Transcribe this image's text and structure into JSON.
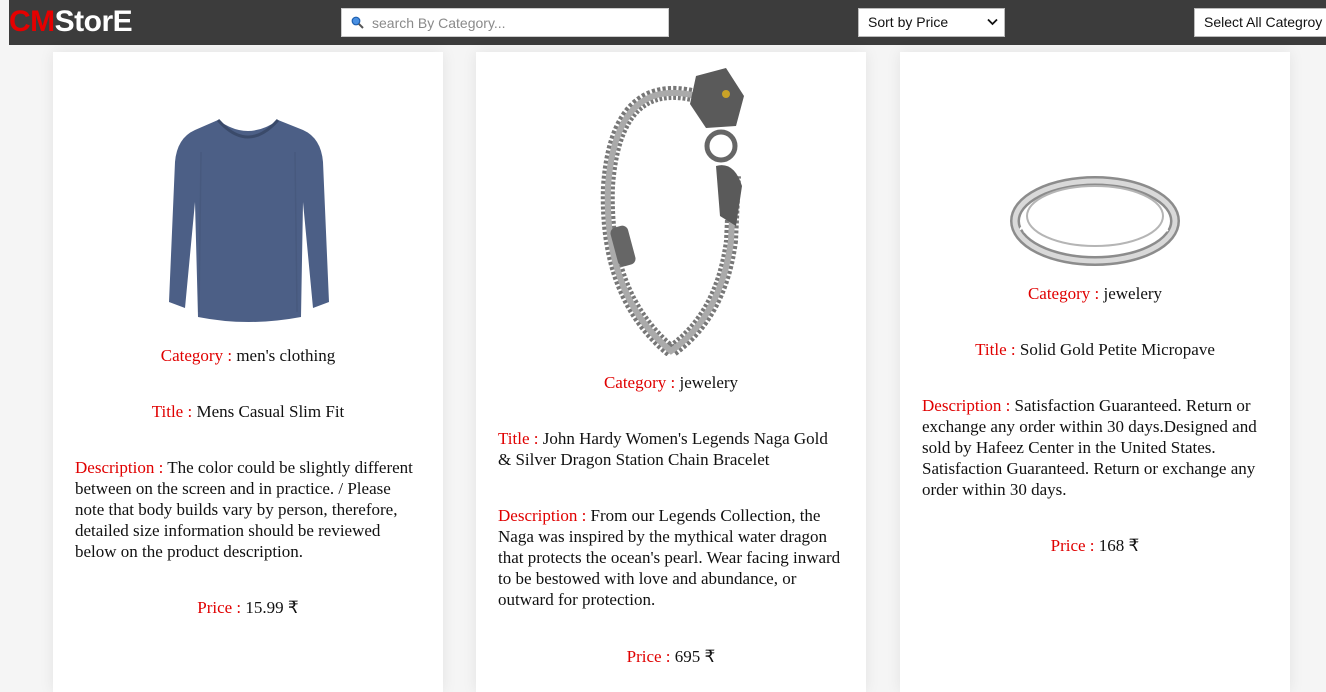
{
  "brand": {
    "prefix": "CM",
    "suffix": "StorE"
  },
  "search": {
    "placeholder": "search By Category..."
  },
  "sort": {
    "selected": "Sort by Price"
  },
  "category_select": {
    "selected": "Select All Categroy"
  },
  "labels": {
    "category": "Category : ",
    "title": "Title : ",
    "description": "Description : ",
    "price": "Price : "
  },
  "products": [
    {
      "image": "long-sleeve-shirt-image",
      "category": "men's clothing",
      "title": "Mens Casual Slim Fit",
      "description": "The color could be slightly different between on the screen and in practice. / Please note that body builds vary by person, therefore, detailed size information should be reviewed below on the product description.",
      "price": "15.99 ₹"
    },
    {
      "image": "dragon-bracelet-image",
      "category": "jewelery",
      "title": "John Hardy Women's Legends Naga Gold & Silver Dragon Station Chain Bracelet",
      "description": "From our Legends Collection, the Naga was inspired by the mythical water dragon that protects the ocean's pearl. Wear facing inward to be bestowed with love and abundance, or outward for protection.",
      "price": "695 ₹"
    },
    {
      "image": "ring-image",
      "category": "jewelery",
      "title": "Solid Gold Petite Micropave",
      "description": "Satisfaction Guaranteed. Return or exchange any order within 30 days.Designed and sold by Hafeez Center in the United States. Satisfaction Guaranteed. Return or exchange any order within 30 days.",
      "price": "168 ₹"
    }
  ],
  "colors": {
    "topbar": "#3c3c3c",
    "accent": "#e00000",
    "background": "#f5f5f5"
  }
}
